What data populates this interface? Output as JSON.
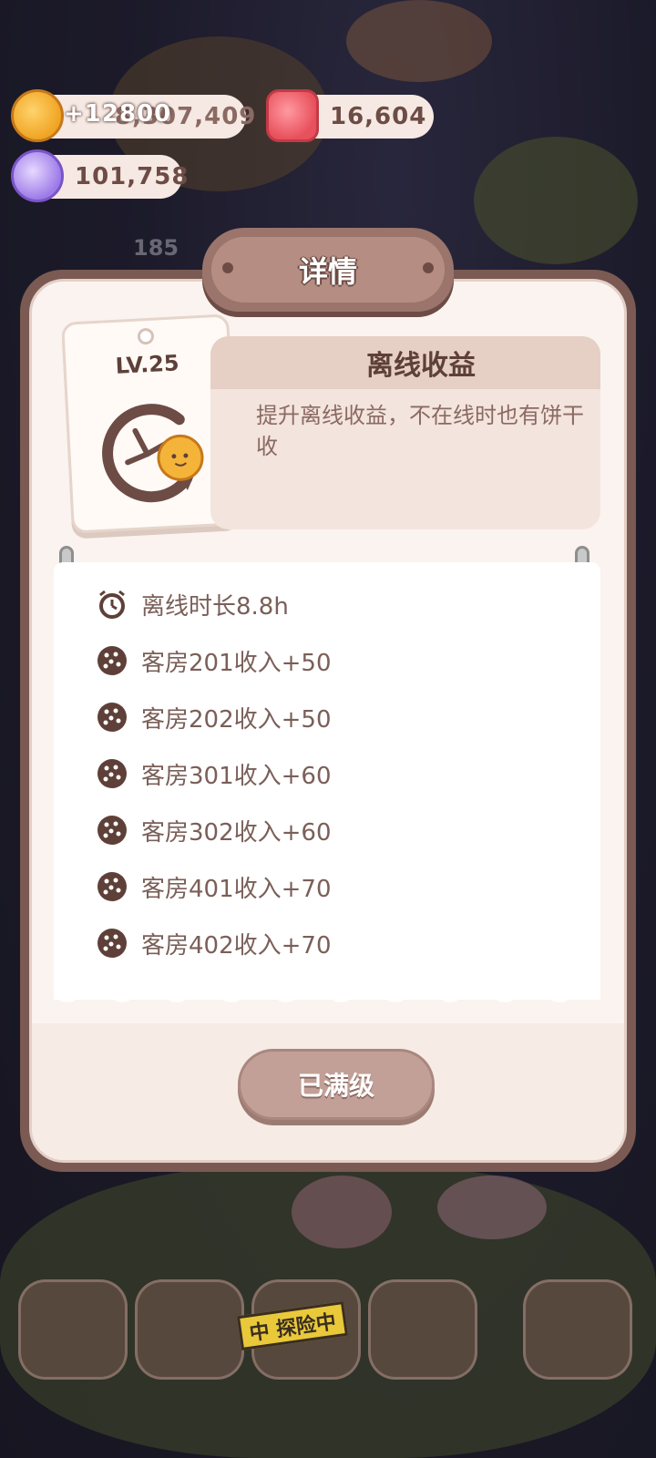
{
  "currencies": {
    "cookie": {
      "value": "8,307,409",
      "gain": "+12800"
    },
    "gem": {
      "value": "16,604"
    },
    "candy": {
      "value": "101,758"
    }
  },
  "background": {
    "counter": "185"
  },
  "dialog": {
    "title": "详情",
    "level": "LV.25",
    "skill_name": "离线收益",
    "skill_desc": "提升离线收益，不在线时也有饼干收",
    "items": [
      {
        "icon": "alarm-clock-icon",
        "text": "离线时长8.8h"
      },
      {
        "icon": "cookie-icon",
        "text": "客房201收入+50"
      },
      {
        "icon": "cookie-icon",
        "text": "客房202收入+50"
      },
      {
        "icon": "cookie-icon",
        "text": "客房301收入+60"
      },
      {
        "icon": "cookie-icon",
        "text": "客房302收入+60"
      },
      {
        "icon": "cookie-icon",
        "text": "客房401收入+70"
      },
      {
        "icon": "cookie-icon",
        "text": "客房402收入+70"
      }
    ],
    "button_label": "已满级"
  },
  "bottom_nav": {
    "explore_badge": "中 探险中"
  },
  "colors": {
    "frame": "#7a5a52",
    "panel": "#fbf3ef",
    "text": "#5e4039",
    "button": "#c2a097"
  }
}
